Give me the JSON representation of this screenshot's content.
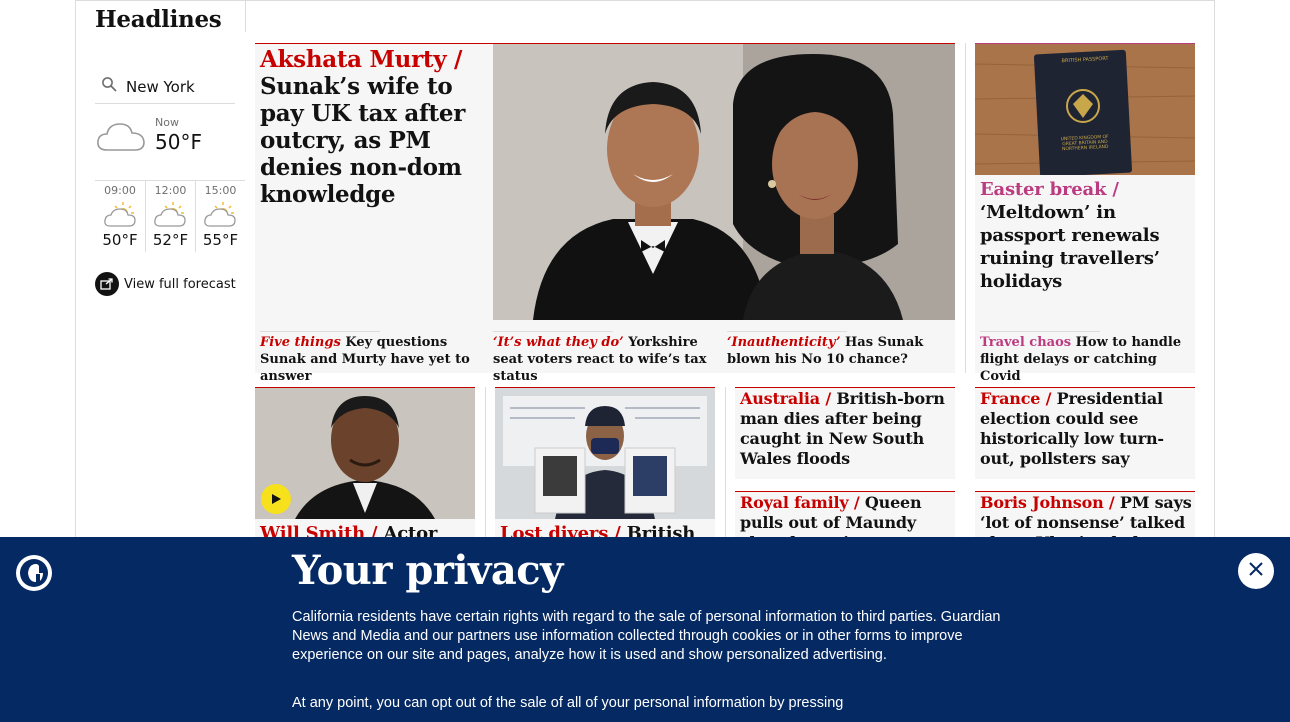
{
  "section": {
    "title": "Headlines"
  },
  "weather": {
    "location": "New York",
    "now_label": "Now",
    "now_temp": "50°F",
    "hours": [
      {
        "time": "09:00",
        "temp": "50°F",
        "icon": "sun-cloud-icon"
      },
      {
        "time": "12:00",
        "temp": "52°F",
        "icon": "sun-cloud-icon"
      },
      {
        "time": "15:00",
        "temp": "55°F",
        "icon": "sun-cloud-icon"
      }
    ],
    "forecast_link": "View full forecast"
  },
  "main_story": {
    "kicker": "Akshata Murty /",
    "headline": "Sunak’s wife to pay UK tax after outcry, as PM denies non-dom knowledge",
    "subs": [
      {
        "kicker": "Five things",
        "text": "Key questions Sunak and Murty have yet to answer"
      },
      {
        "kicker": "‘It’s what they do’",
        "text": "Yorkshire seat voters react to wife’s tax status"
      },
      {
        "kicker": "‘Inauthenticity’",
        "text": "Has Sunak blown his No 10 chance?"
      }
    ]
  },
  "passport_story": {
    "kicker": "Easter break /",
    "headline": "‘Meltdown’ in passport renewals ruining travellers’ holidays",
    "passport_text": [
      "BRITISH PASSPORT",
      "UNITED KINGDOM OF GREAT BRITAIN AND NORTHERN IRELAND"
    ],
    "sub": {
      "kicker": "Travel chaos",
      "text": "How to handle flight delays or catching Covid"
    }
  },
  "row2": [
    {
      "kicker": "Will Smith /",
      "headline": "Actor"
    },
    {
      "kicker": "Lost divers /",
      "headline": "British"
    },
    {
      "kicker": "Australia /",
      "headline": "British-born man dies after being caught in New South Wales floods"
    },
    {
      "kicker": "France /",
      "headline": "Presidential election could see historically low turn-out, pollsters say"
    }
  ],
  "row3": [
    {
      "kicker": "Royal family /",
      "headline": "Queen pulls out of Maundy church service"
    },
    {
      "kicker": "Boris Johnson /",
      "headline": "PM says ‘lot of nonsense’ talked about Ukraine help"
    }
  ],
  "privacy": {
    "title": "Your privacy",
    "para1": "California residents have certain rights with regard to the sale of personal information to third parties. Guardian News and Media and our partners use information collected through cookies or in other forms to improve experience on our site and pages, analyze how it is used and show personalized advertising.",
    "para2": "At any point, you can opt out of the sale of all of your personal information by pressing"
  },
  "colors": {
    "news_red": "#c70000",
    "lifestyle_pink": "#bb3b80",
    "navy": "#052962",
    "card_bg": "#f6f6f6"
  }
}
